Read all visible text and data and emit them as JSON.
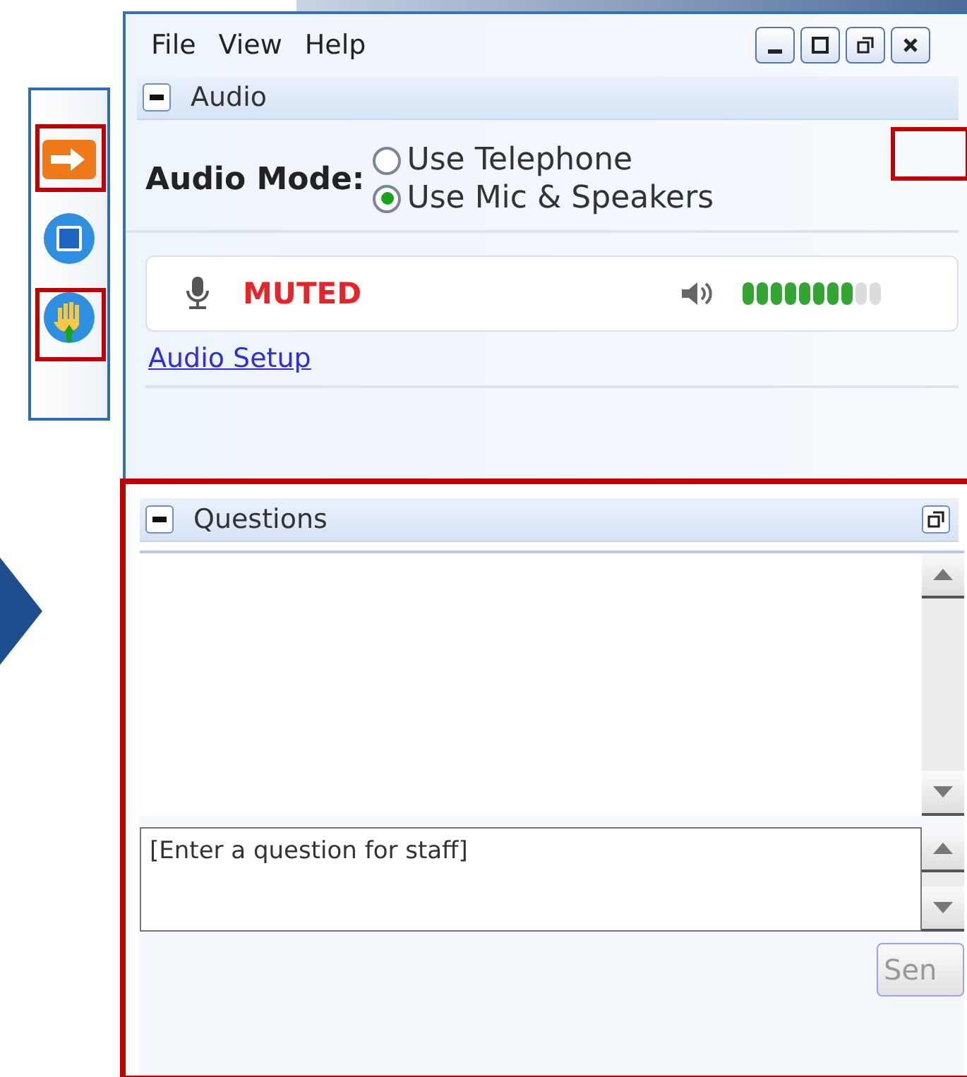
{
  "menu": [
    "File",
    "View",
    "Help"
  ],
  "audio": {
    "title": "Audio",
    "mode_label": "Audio Mode:",
    "options": [
      {
        "label": "Use Telephone",
        "selected": false
      },
      {
        "label": "Use Mic & Speakers",
        "selected": true
      }
    ],
    "mic_status": "MUTED",
    "speaker": {
      "level": 0.8
    },
    "setup_link": "Audio Setup"
  },
  "questions": {
    "title": "Questions",
    "placeholder": "[Enter a question for staff]",
    "send": "Sen"
  }
}
